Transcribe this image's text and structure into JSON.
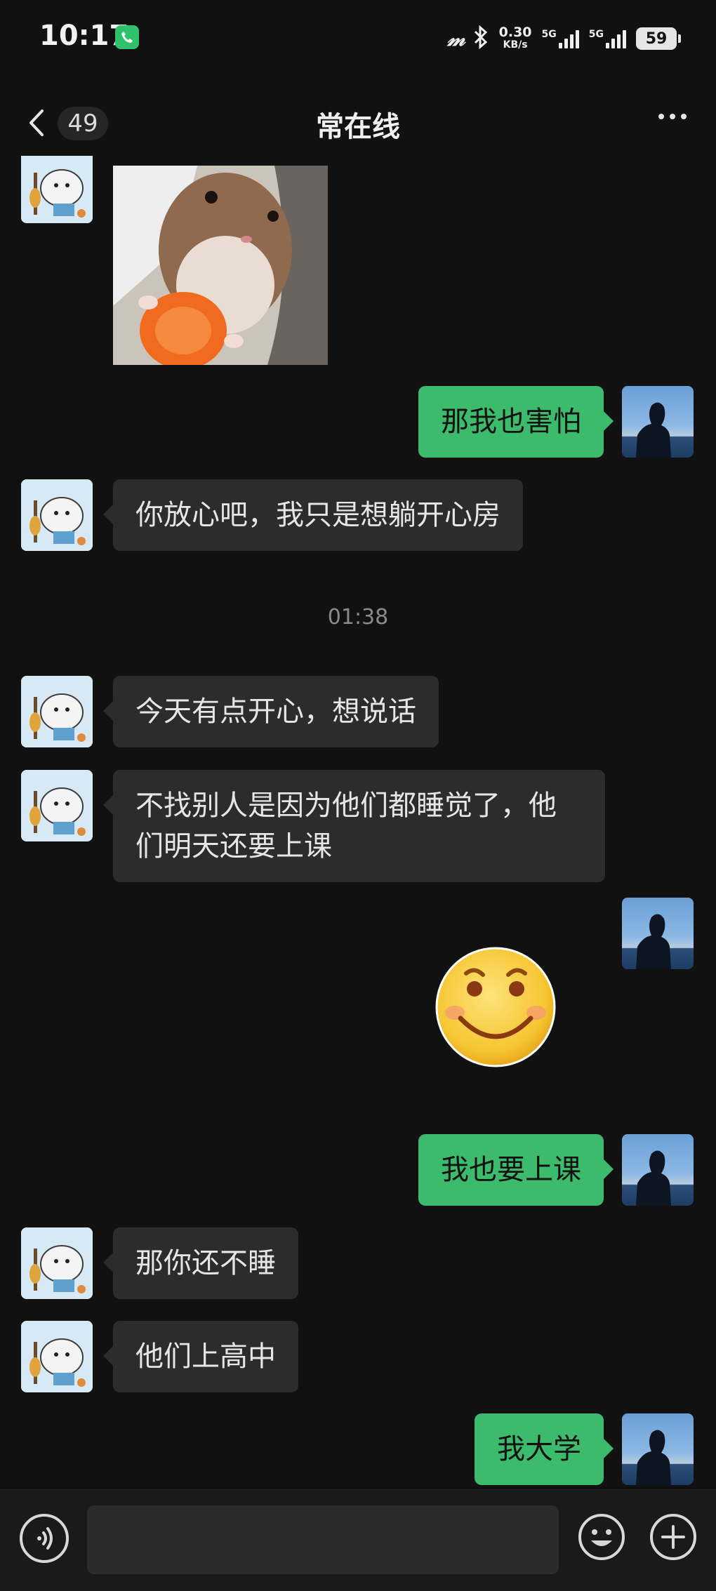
{
  "status_bar": {
    "time": "10:17",
    "net_speed": "0.30",
    "net_unit": "KB/s",
    "sim1": "5G",
    "sim2": "5G",
    "battery": "59"
  },
  "header": {
    "unread_count": "49",
    "title": "常在线"
  },
  "messages": {
    "m1": "那我也害怕",
    "m2": "你放心吧，我只是想躺开心房",
    "timestamp": "01:38",
    "m3": "今天有点开心，想说话",
    "m4_line1": "不找别人是因为他们都睡觉了，他",
    "m4_line2": "们明天还要上课",
    "m5": "我也要上课",
    "m6": "那你还不睡",
    "m7": "他们上高中",
    "m8": "我大学"
  },
  "colors": {
    "background": "#111111",
    "sent_bubble": "#3dbb6d",
    "received_bubble": "#2c2c2c"
  },
  "icons": {
    "back": "chevron-left-icon",
    "more": "more-dots-icon",
    "voice": "voice-icon",
    "emoji": "emoji-icon",
    "plus": "plus-icon"
  }
}
